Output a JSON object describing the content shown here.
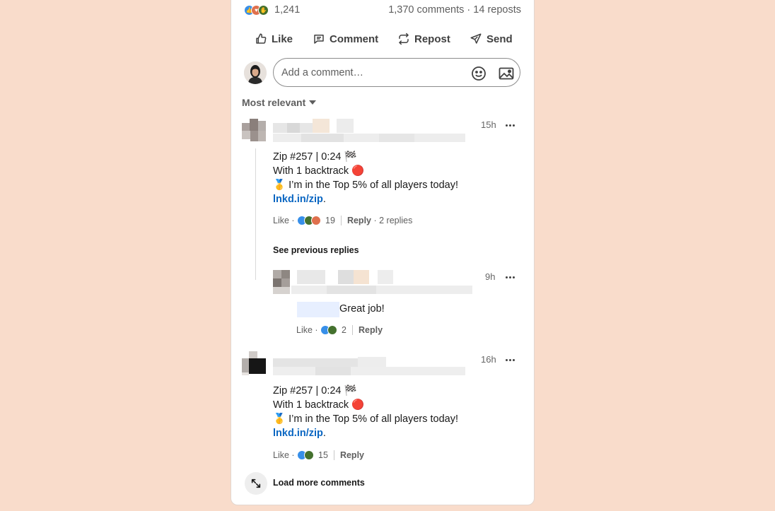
{
  "social": {
    "reaction_count": "1,241",
    "summary": "1,370 comments · 14 reposts",
    "reaction_icons": [
      "like-icon",
      "love-icon",
      "celebrate-icon"
    ]
  },
  "actions": {
    "like": "Like",
    "comment": "Comment",
    "repost": "Repost",
    "send": "Send"
  },
  "composer": {
    "placeholder": "Add a comment…"
  },
  "sort": {
    "label": "Most relevant"
  },
  "comments": [
    {
      "time": "15h",
      "lines": [
        "Zip #257 | 0:24 🏁",
        "With 1 backtrack 🔴",
        "🥇 I’m in the Top 5% of all players today!"
      ],
      "link_text": "lnkd.in/zip",
      "link_suffix": ".",
      "like_label": "Like",
      "reaction_count": "19",
      "reply_label": "Reply",
      "replies_label": "2 replies"
    },
    {
      "time": "16h",
      "lines": [
        "Zip #257 | 0:24 🏁",
        "With 1 backtrack 🔴",
        "🥇 I’m in the Top 5% of all players today!"
      ],
      "link_text": "lnkd.in/zip",
      "link_suffix": ".",
      "like_label": "Like",
      "reaction_count": "15",
      "reply_label": "Reply"
    }
  ],
  "see_previous": "See previous replies",
  "reply": {
    "time": "9h",
    "text": "Great job!",
    "like_label": "Like",
    "reaction_count": "2",
    "reply_label": "Reply"
  },
  "load_more": "Load more comments",
  "colors": {
    "background": "#f9dccb",
    "link": "#0a66c2",
    "like_blue": "#378fe9",
    "celebrate_green": "#44712e",
    "love_red": "#df704d"
  }
}
